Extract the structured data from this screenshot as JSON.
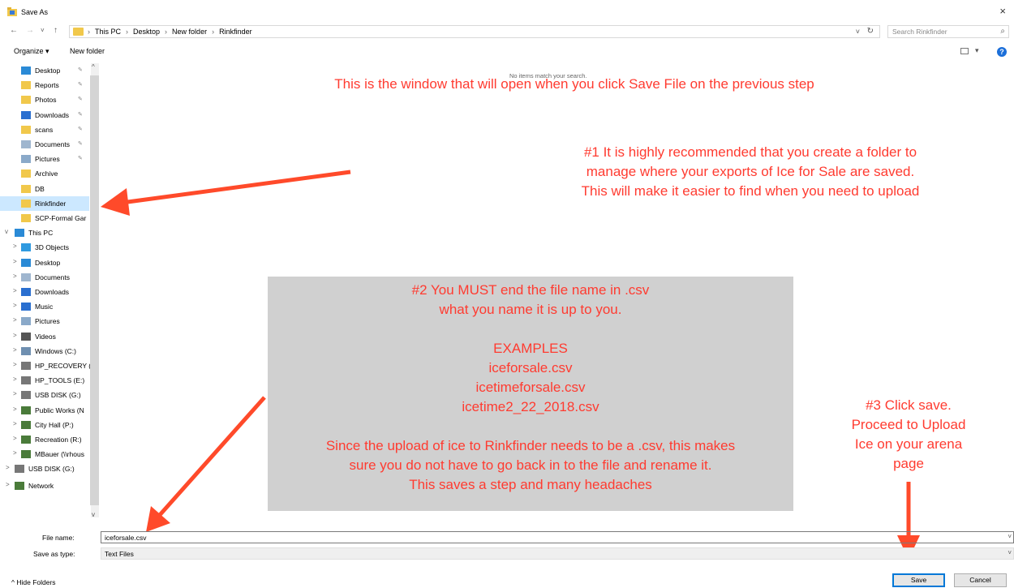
{
  "window": {
    "title": "Save As",
    "close_symbol": "×"
  },
  "navigation": {
    "back": "←",
    "forward": "→",
    "recent": "˅",
    "up": "↑",
    "breadcrumb": [
      "This PC",
      "Desktop",
      "New folder",
      "Rinkfinder"
    ],
    "separator": "›",
    "search_placeholder": "Search Rinkfinder"
  },
  "commands": {
    "organize": "Organize ▾",
    "new_folder": "New folder",
    "help": "?"
  },
  "nav_pane": {
    "quick_access": [
      {
        "label": "Desktop",
        "icon": "desktop-icon",
        "pinned": true
      },
      {
        "label": "Reports",
        "icon": "folder-icon",
        "pinned": true
      },
      {
        "label": "Photos",
        "icon": "folder-icon",
        "pinned": true
      },
      {
        "label": "Downloads",
        "icon": "download-icon",
        "pinned": true
      },
      {
        "label": "scans",
        "icon": "folder-icon",
        "pinned": true
      },
      {
        "label": "Documents",
        "icon": "documents-icon",
        "pinned": true
      },
      {
        "label": "Pictures",
        "icon": "pictures-icon",
        "pinned": true
      },
      {
        "label": "Archive",
        "icon": "folder-icon",
        "pinned": false
      },
      {
        "label": "DB",
        "icon": "folder-icon",
        "pinned": false
      },
      {
        "label": "Rinkfinder",
        "icon": "folder-icon",
        "pinned": false,
        "selected": true
      },
      {
        "label": "SCP-Formal Gar",
        "icon": "folder-icon",
        "pinned": false
      }
    ],
    "this_pc": {
      "label": "This PC",
      "children": [
        {
          "label": "3D Objects",
          "icon": "3d-objects-icon"
        },
        {
          "label": "Desktop",
          "icon": "desktop-icon"
        },
        {
          "label": "Documents",
          "icon": "documents-icon"
        },
        {
          "label": "Downloads",
          "icon": "download-icon"
        },
        {
          "label": "Music",
          "icon": "music-icon"
        },
        {
          "label": "Pictures",
          "icon": "pictures-icon"
        },
        {
          "label": "Videos",
          "icon": "videos-icon"
        },
        {
          "label": "Windows (C:)",
          "icon": "windows-drive-icon"
        },
        {
          "label": "HP_RECOVERY (",
          "icon": "drive-icon"
        },
        {
          "label": "HP_TOOLS (E:)",
          "icon": "drive-icon"
        },
        {
          "label": "USB DISK (G:)",
          "icon": "drive-icon"
        },
        {
          "label": "Public Works (N",
          "icon": "network-drive-icon"
        },
        {
          "label": "City Hall (P:)",
          "icon": "network-drive-icon"
        },
        {
          "label": "Recreation (R:)",
          "icon": "network-drive-icon"
        },
        {
          "label": "MBauer (\\\\rhous",
          "icon": "network-drive-icon"
        }
      ]
    },
    "usb_disk": "USB DISK (G:)",
    "network": "Network"
  },
  "content": {
    "empty_message": "No items match your search."
  },
  "form": {
    "file_name_label": "File name:",
    "file_name_value": "iceforsale.csv",
    "save_type_label": "Save as type:",
    "save_type_value": "Text Files"
  },
  "footer": {
    "hide_folders": "^  Hide Folders",
    "save": "Save",
    "cancel": "Cancel"
  },
  "annotations": {
    "intro": "This is the window that will open when you click Save File on the previous step",
    "step1": [
      "#1 It is highly recommended that you create a folder to",
      "manage where your exports of Ice for Sale are saved.",
      "This will make it easier to find when you need to upload"
    ],
    "step2": [
      "#2 You MUST end the file name in .csv",
      "what you name it is up to you.",
      "",
      "EXAMPLES",
      "iceforsale.csv",
      "icetimeforsale.csv",
      "icetime2_22_2018.csv",
      "",
      "Since the upload of ice to Rinkfinder needs to be a .csv, this makes",
      "sure you do not have to go back in to the file and rename it.",
      "This saves a step and many headaches"
    ],
    "step3": [
      "#3 Click save.",
      "Proceed to Upload",
      "Ice on your arena",
      "page"
    ],
    "arrow_color": "#ff4a2a",
    "text_color": "#ff3b30"
  }
}
